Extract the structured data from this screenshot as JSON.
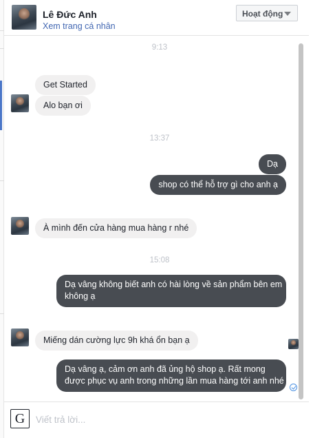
{
  "header": {
    "name": "Lê Đức Anh",
    "profile_link": "Xem trang cá nhân",
    "status": "Hoạt động"
  },
  "thread": {
    "times": [
      "9:13",
      "13:37",
      "15:08"
    ],
    "messages": [
      {
        "side": "in",
        "text": "Get Started"
      },
      {
        "side": "in",
        "text": "Alo bạn ơi"
      },
      {
        "side": "out",
        "text": "Dạ"
      },
      {
        "side": "out",
        "text": "shop có thể hỗ trợ gì cho anh ạ"
      },
      {
        "side": "in",
        "text": "À mình đến cửa hàng mua hàng r nhé"
      },
      {
        "side": "out",
        "lines": [
          "Dạ vâng không biết anh có hài lòng về sản phẩm bên em",
          "không ạ"
        ]
      },
      {
        "side": "in",
        "text": "Miếng dán cường lực 9h khá ổn bạn ạ"
      },
      {
        "side": "out",
        "lines": [
          "Dạ vâng ạ, cảm ơn anh đã ủng hộ shop ạ. Rất mong",
          "được phục vụ anh trong những lần mua hàng tới anh nhé"
        ]
      }
    ]
  },
  "composer": {
    "icon_letter": "G",
    "placeholder": "Viết trả lời..."
  }
}
